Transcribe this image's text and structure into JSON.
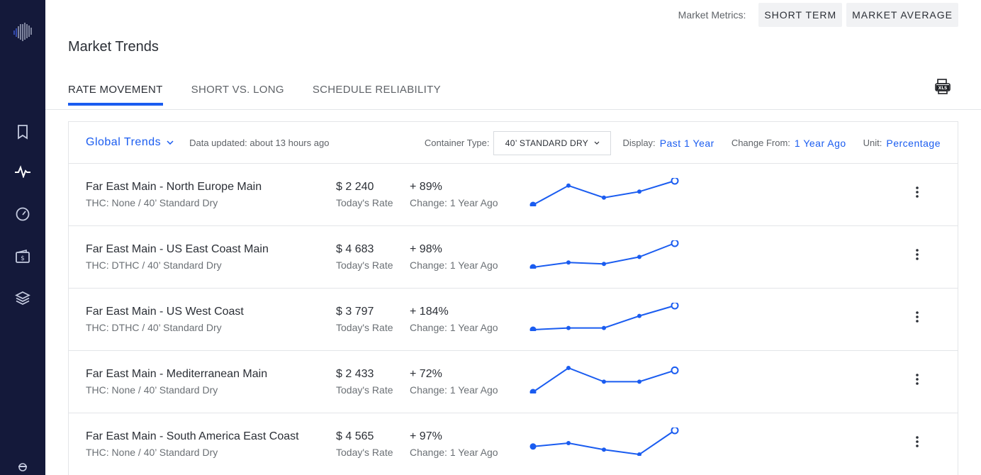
{
  "colors": {
    "sidebar": "#14193a",
    "accent": "#1a5cf0",
    "border": "#e3e5e8"
  },
  "sidebar": {
    "logo": "barcode-logo",
    "items": [
      {
        "icon": "bookmark-icon"
      },
      {
        "icon": "activity-pulse-icon",
        "active": true
      },
      {
        "icon": "gauge-icon"
      },
      {
        "icon": "wallet-dollar-icon"
      },
      {
        "icon": "layers-icon"
      }
    ],
    "avatar": "user-avatar-icon"
  },
  "topbar": {
    "label": "Market Metrics:",
    "buttons": [
      "SHORT TERM",
      "MARKET AVERAGE"
    ]
  },
  "page": {
    "title": "Market Trends"
  },
  "tabs": [
    {
      "label": "RATE MOVEMENT",
      "active": true
    },
    {
      "label": "SHORT VS. LONG"
    },
    {
      "label": "SCHEDULE RELIABILITY"
    }
  ],
  "export_icon": "xls-export-icon",
  "card": {
    "title": "Global Trends",
    "updated": "Data updated: about 13 hours ago",
    "filters": {
      "container_label": "Container Type:",
      "container_value": "40’ STANDARD DRY",
      "display_label": "Display:",
      "display_value": "Past 1 Year",
      "change_label": "Change From:",
      "change_value": "1 Year Ago",
      "unit_label": "Unit:",
      "unit_value": "Percentage"
    },
    "rows": [
      {
        "route": "Far East Main - North Europe Main",
        "sub": "THC: None / 40’ Standard Dry",
        "rate": "$ 2 240",
        "rate_label": "Today's Rate",
        "change": "+ 89%",
        "change_label": "Change: 1 Year Ago",
        "trend": [
          0.0,
          0.8,
          0.3,
          0.55,
          1.0
        ]
      },
      {
        "route": "Far East Main - US East Coast Main",
        "sub": "THC: DTHC / 40’ Standard Dry",
        "rate": "$ 4 683",
        "rate_label": "Today's Rate",
        "change": "+ 98%",
        "change_label": "Change: 1 Year Ago",
        "trend": [
          0.0,
          0.2,
          0.14,
          0.43,
          1.0
        ]
      },
      {
        "route": "Far East Main - US West Coast",
        "sub": "THC: DTHC / 40’ Standard Dry",
        "rate": "$ 3 797",
        "rate_label": "Today's Rate",
        "change": "+ 184%",
        "change_label": "Change: 1 Year Ago",
        "trend": [
          0.0,
          0.07,
          0.07,
          0.57,
          1.0
        ]
      },
      {
        "route": "Far East Main - Mediterranean Main",
        "sub": "THC: None / 40’ Standard Dry",
        "rate": "$ 2 433",
        "rate_label": "Today's Rate",
        "change": "+ 72%",
        "change_label": "Change: 1 Year Ago",
        "trend": [
          0.0,
          1.0,
          0.43,
          0.43,
          0.9
        ]
      },
      {
        "route": "Far East Main - South America East Coast",
        "sub": "THC: None / 40’ Standard Dry",
        "rate": "$ 4 565",
        "rate_label": "Today's Rate",
        "change": "+ 97%",
        "change_label": "Change: 1 Year Ago",
        "trend": [
          0.33,
          0.47,
          0.2,
          0.0,
          1.0
        ]
      }
    ]
  }
}
